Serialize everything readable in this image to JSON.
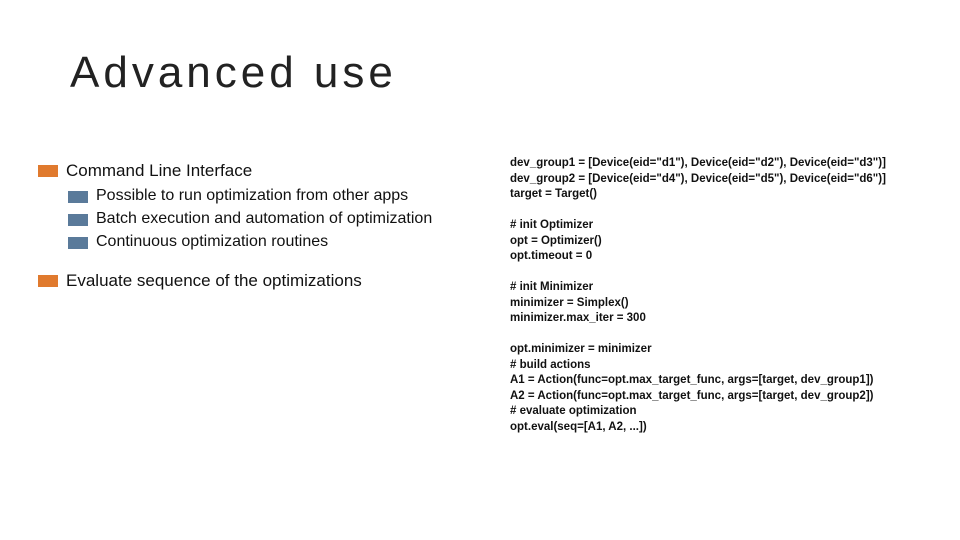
{
  "title": "Advanced use",
  "bullets": {
    "b1": "Command Line Interface",
    "b1_subs": [
      "Possible to run optimization from other apps",
      "Batch execution and automation of optimization",
      "Continuous optimization routines"
    ],
    "b2": "Evaluate sequence of the optimizations"
  },
  "code": "dev_group1 = [Device(eid=\"d1\"), Device(eid=\"d2\"), Device(eid=\"d3\")]\ndev_group2 = [Device(eid=\"d4\"), Device(eid=\"d5\"), Device(eid=\"d6\")]\ntarget = Target()\n\n# init Optimizer\nopt = Optimizer()\nopt.timeout = 0\n\n# init Minimizer\nminimizer = Simplex()\nminimizer.max_iter = 300\n\nopt.minimizer = minimizer\n# build actions\nA1 = Action(func=opt.max_target_func, args=[target, dev_group1])\nA2 = Action(func=opt.max_target_func, args=[target, dev_group2])\n# evaluate optimization\nopt.eval(seq=[A1, A2, ...])"
}
